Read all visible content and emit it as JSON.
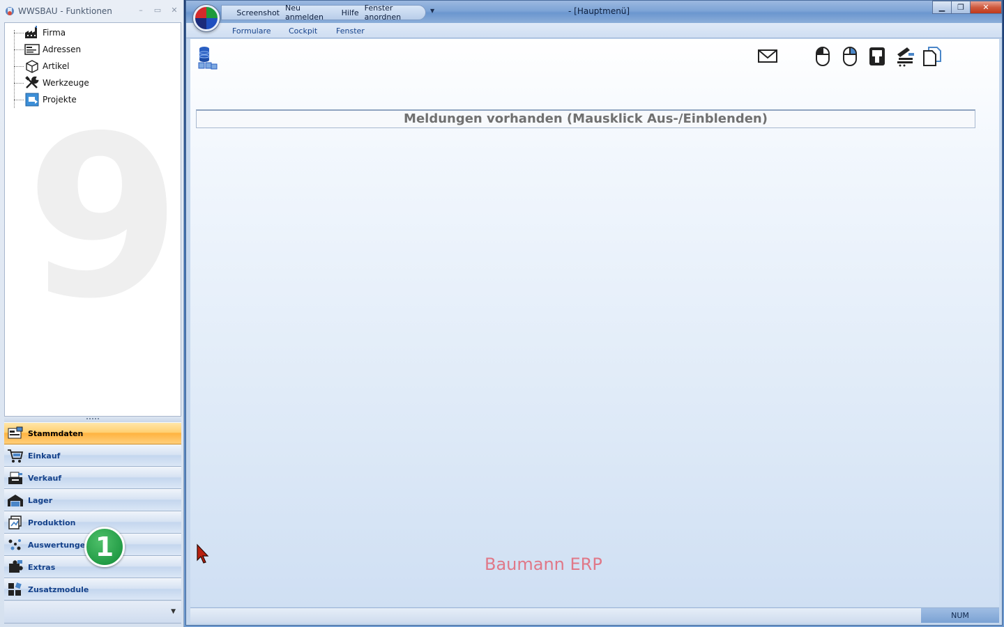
{
  "left_window": {
    "title": "WWSBAU - Funktionen",
    "tree": [
      {
        "label": "Firma",
        "icon": "factory-icon"
      },
      {
        "label": "Adressen",
        "icon": "address-card-icon"
      },
      {
        "label": "Artikel",
        "icon": "package-icon"
      },
      {
        "label": "Werkzeuge",
        "icon": "tools-icon"
      },
      {
        "label": "Projekte",
        "icon": "project-icon"
      }
    ],
    "watermark": "9",
    "nav": [
      {
        "label": "Stammdaten",
        "active": true
      },
      {
        "label": "Einkauf"
      },
      {
        "label": "Verkauf"
      },
      {
        "label": "Lager"
      },
      {
        "label": "Produktion"
      },
      {
        "label": "Auswertungen"
      },
      {
        "label": "Extras"
      },
      {
        "label": "Zusatzmodule"
      }
    ]
  },
  "step_badge": "1",
  "main_window": {
    "title": "- [Hauptmenü]",
    "quick_access": [
      "Screenshot",
      "Neu anmelden",
      "Hilfe",
      "Fenster anordnen"
    ],
    "ribbon_tabs": [
      "Formulare",
      "Cockpit",
      "Fenster"
    ],
    "toolbar_icons": [
      "mail-icon",
      "mouse-left-icon",
      "mouse-right-icon",
      "keyboard-icon",
      "network-tool-icon",
      "documents-icon"
    ],
    "messages_banner": "Meldungen vorhanden  (Mausklick Aus-/Einblenden)",
    "brand": "Baumann ERP",
    "status": {
      "num": "NUM"
    }
  },
  "colors": {
    "active_nav": "#ffb340",
    "nav_text": "#15428b",
    "brand": "#e07888",
    "badge": "#239c46"
  }
}
